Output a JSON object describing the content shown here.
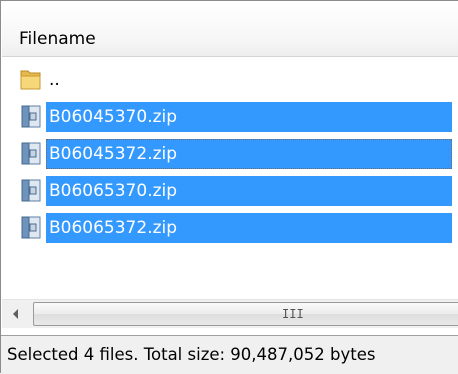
{
  "file_list": {
    "header": {
      "filename_label": "Filename"
    },
    "rows": [
      {
        "name": "..",
        "type": "folder-up",
        "icon": "folder-icon",
        "selected": false
      },
      {
        "name": "B06045370.zip",
        "type": "zip",
        "icon": "zip-archive-icon",
        "selected": true
      },
      {
        "name": "B06045372.zip",
        "type": "zip",
        "icon": "zip-archive-icon",
        "selected": true,
        "focused": true
      },
      {
        "name": "B06065370.zip",
        "type": "zip",
        "icon": "zip-archive-icon",
        "selected": true
      },
      {
        "name": "B06065372.zip",
        "type": "zip",
        "icon": "zip-archive-icon",
        "selected": true
      }
    ]
  },
  "scrollbar": {
    "left_arrow_icon": "chevron-left-icon",
    "grip_glyph": "III"
  },
  "statusbar": {
    "text": "Selected 4 files. Total size: 90,487,052 bytes"
  },
  "colors": {
    "selection": "#3399ff",
    "selection_text": "#ffffff",
    "statusbar_bg": "#f0f0f0"
  }
}
